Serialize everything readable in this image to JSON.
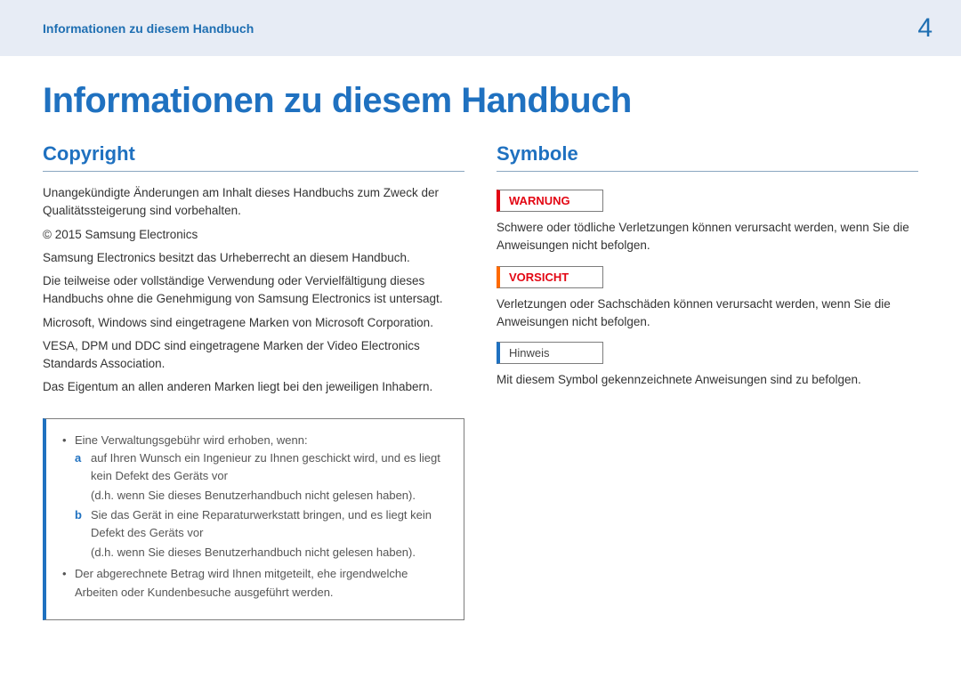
{
  "header": {
    "breadcrumb": "Informationen zu diesem Handbuch",
    "page_number": "4"
  },
  "title": "Informationen zu diesem Handbuch",
  "left": {
    "heading": "Copyright",
    "p1": "Unangekündigte Änderungen am Inhalt dieses Handbuchs zum Zweck der Qualitätssteigerung sind vorbehalten.",
    "p2": "© 2015 Samsung Electronics",
    "p3": "Samsung Electronics besitzt das Urheberrecht an diesem Handbuch.",
    "p4": "Die teilweise oder vollständige Verwendung oder Vervielfältigung dieses Handbuchs ohne die Genehmigung von Samsung Electronics ist untersagt.",
    "p5": "Microsoft, Windows sind eingetragene Marken von Microsoft Corporation.",
    "p6": "VESA, DPM und DDC sind eingetragene Marken der Video Electronics Standards Association.",
    "p7": "Das Eigentum an allen anderen Marken liegt bei den jeweiligen Inhabern.",
    "box": {
      "bullet1": "Eine Verwaltungsgebühr wird erhoben, wenn:",
      "a_marker": "a",
      "a": "auf Ihren Wunsch ein Ingenieur zu Ihnen geschickt wird, und es liegt kein Defekt des Geräts vor",
      "a_sub": "(d.h. wenn Sie dieses Benutzerhandbuch nicht gelesen haben).",
      "b_marker": "b",
      "b": "Sie das Gerät in eine Reparaturwerkstatt bringen, und es liegt kein Defekt des Geräts vor",
      "b_sub": "(d.h. wenn Sie dieses Benutzerhandbuch nicht gelesen haben).",
      "bullet2": "Der abgerechnete Betrag wird Ihnen mitgeteilt, ehe irgendwelche Arbeiten oder Kundenbesuche ausgeführt werden."
    }
  },
  "right": {
    "heading": "Symbole",
    "warn_label": "WARNUNG",
    "warn_text": "Schwere oder tödliche Verletzungen können verursacht werden, wenn Sie die Anweisungen nicht befolgen.",
    "caut_label": "VORSICHT",
    "caut_text": "Verletzungen oder Sachschäden können verursacht werden, wenn Sie die Anweisungen nicht befolgen.",
    "note_label": "Hinweis",
    "note_text": "Mit diesem Symbol gekennzeichnete Anweisungen sind zu befolgen."
  }
}
